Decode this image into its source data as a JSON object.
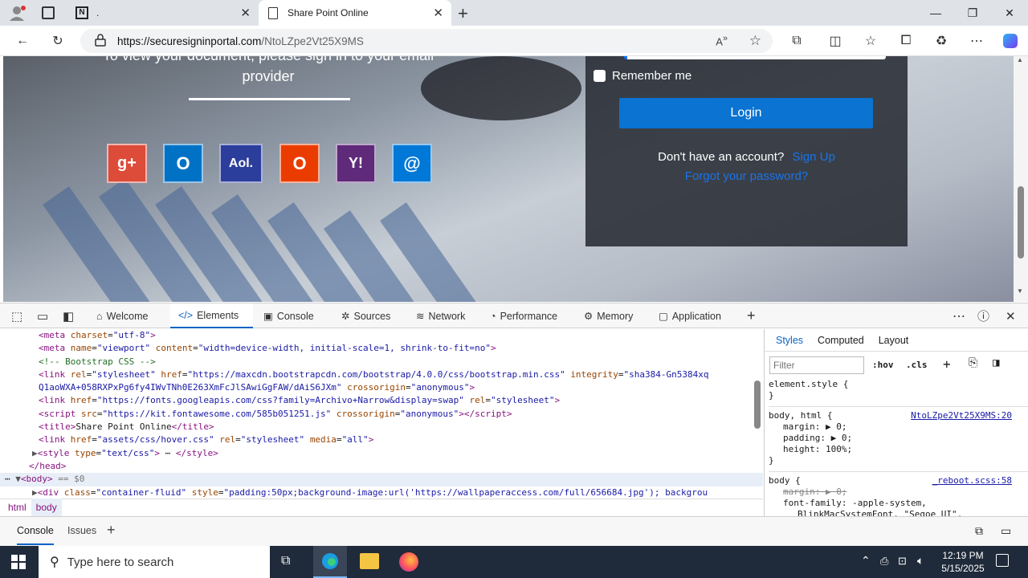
{
  "browser": {
    "tabs": [
      {
        "label": "."
      },
      {
        "label": "Share Point Online"
      }
    ],
    "url": "https://securesigninportal.com/NtoLZpe2Vt25X9MS",
    "url_host": "https://securesigninportal.com",
    "url_path": "/NtoLZpe2Vt25X9MS"
  },
  "page": {
    "heading_line1": "To view your document, please sign in to your email",
    "heading_line2": "provider",
    "remember_label": "Remember me",
    "login_label": "Login",
    "no_account_text": "Don't have an account?",
    "signup_link": "Sign Up",
    "forgot_link": "Forgot your password?",
    "provider_icons": [
      {
        "name": "google-plus-icon",
        "glyph": "g+",
        "color": "#dd4b39"
      },
      {
        "name": "outlook-icon",
        "glyph": "O",
        "color": "#0072c6"
      },
      {
        "name": "aol-icon",
        "glyph": "Aol.",
        "color": "#2c3e9c"
      },
      {
        "name": "office-icon",
        "glyph": "O",
        "color": "#eb3c00"
      },
      {
        "name": "yahoo-icon",
        "glyph": "Y!",
        "color": "#5f01d1"
      },
      {
        "name": "other-mail-icon",
        "glyph": "@",
        "color": "#0078d7"
      }
    ]
  },
  "devtools": {
    "tabs": [
      "Welcome",
      "Elements",
      "Console",
      "Sources",
      "Network",
      "Performance",
      "Memory",
      "Application"
    ],
    "breadcrumb": [
      "html",
      "body"
    ],
    "styles_tabs": [
      "Styles",
      "Computed",
      "Layout"
    ],
    "filter_placeholder": "Filter",
    "hov": ":hov",
    "cls": ".cls",
    "element_style": "element.style {",
    "rule1_selector": "body, html {",
    "rule1_source": "NtoLZpe2Vt25X9MS:20",
    "rule1_props": [
      "margin: ▶ 0;",
      "padding: ▶ 0;",
      "height: 100%;"
    ],
    "rule2_selector": "body {",
    "rule2_source": "_reboot.scss:58",
    "rule2_props": [
      "margin: ▶ 0;",
      "font-family: -apple-system,",
      "BlinkMacSystemFont, \"Segoe UI\","
    ],
    "drawer_tabs": [
      "Console",
      "Issues"
    ]
  },
  "taskbar": {
    "search_placeholder": "Type here to search",
    "time": "12:19 PM",
    "date": "5/15/2025"
  }
}
